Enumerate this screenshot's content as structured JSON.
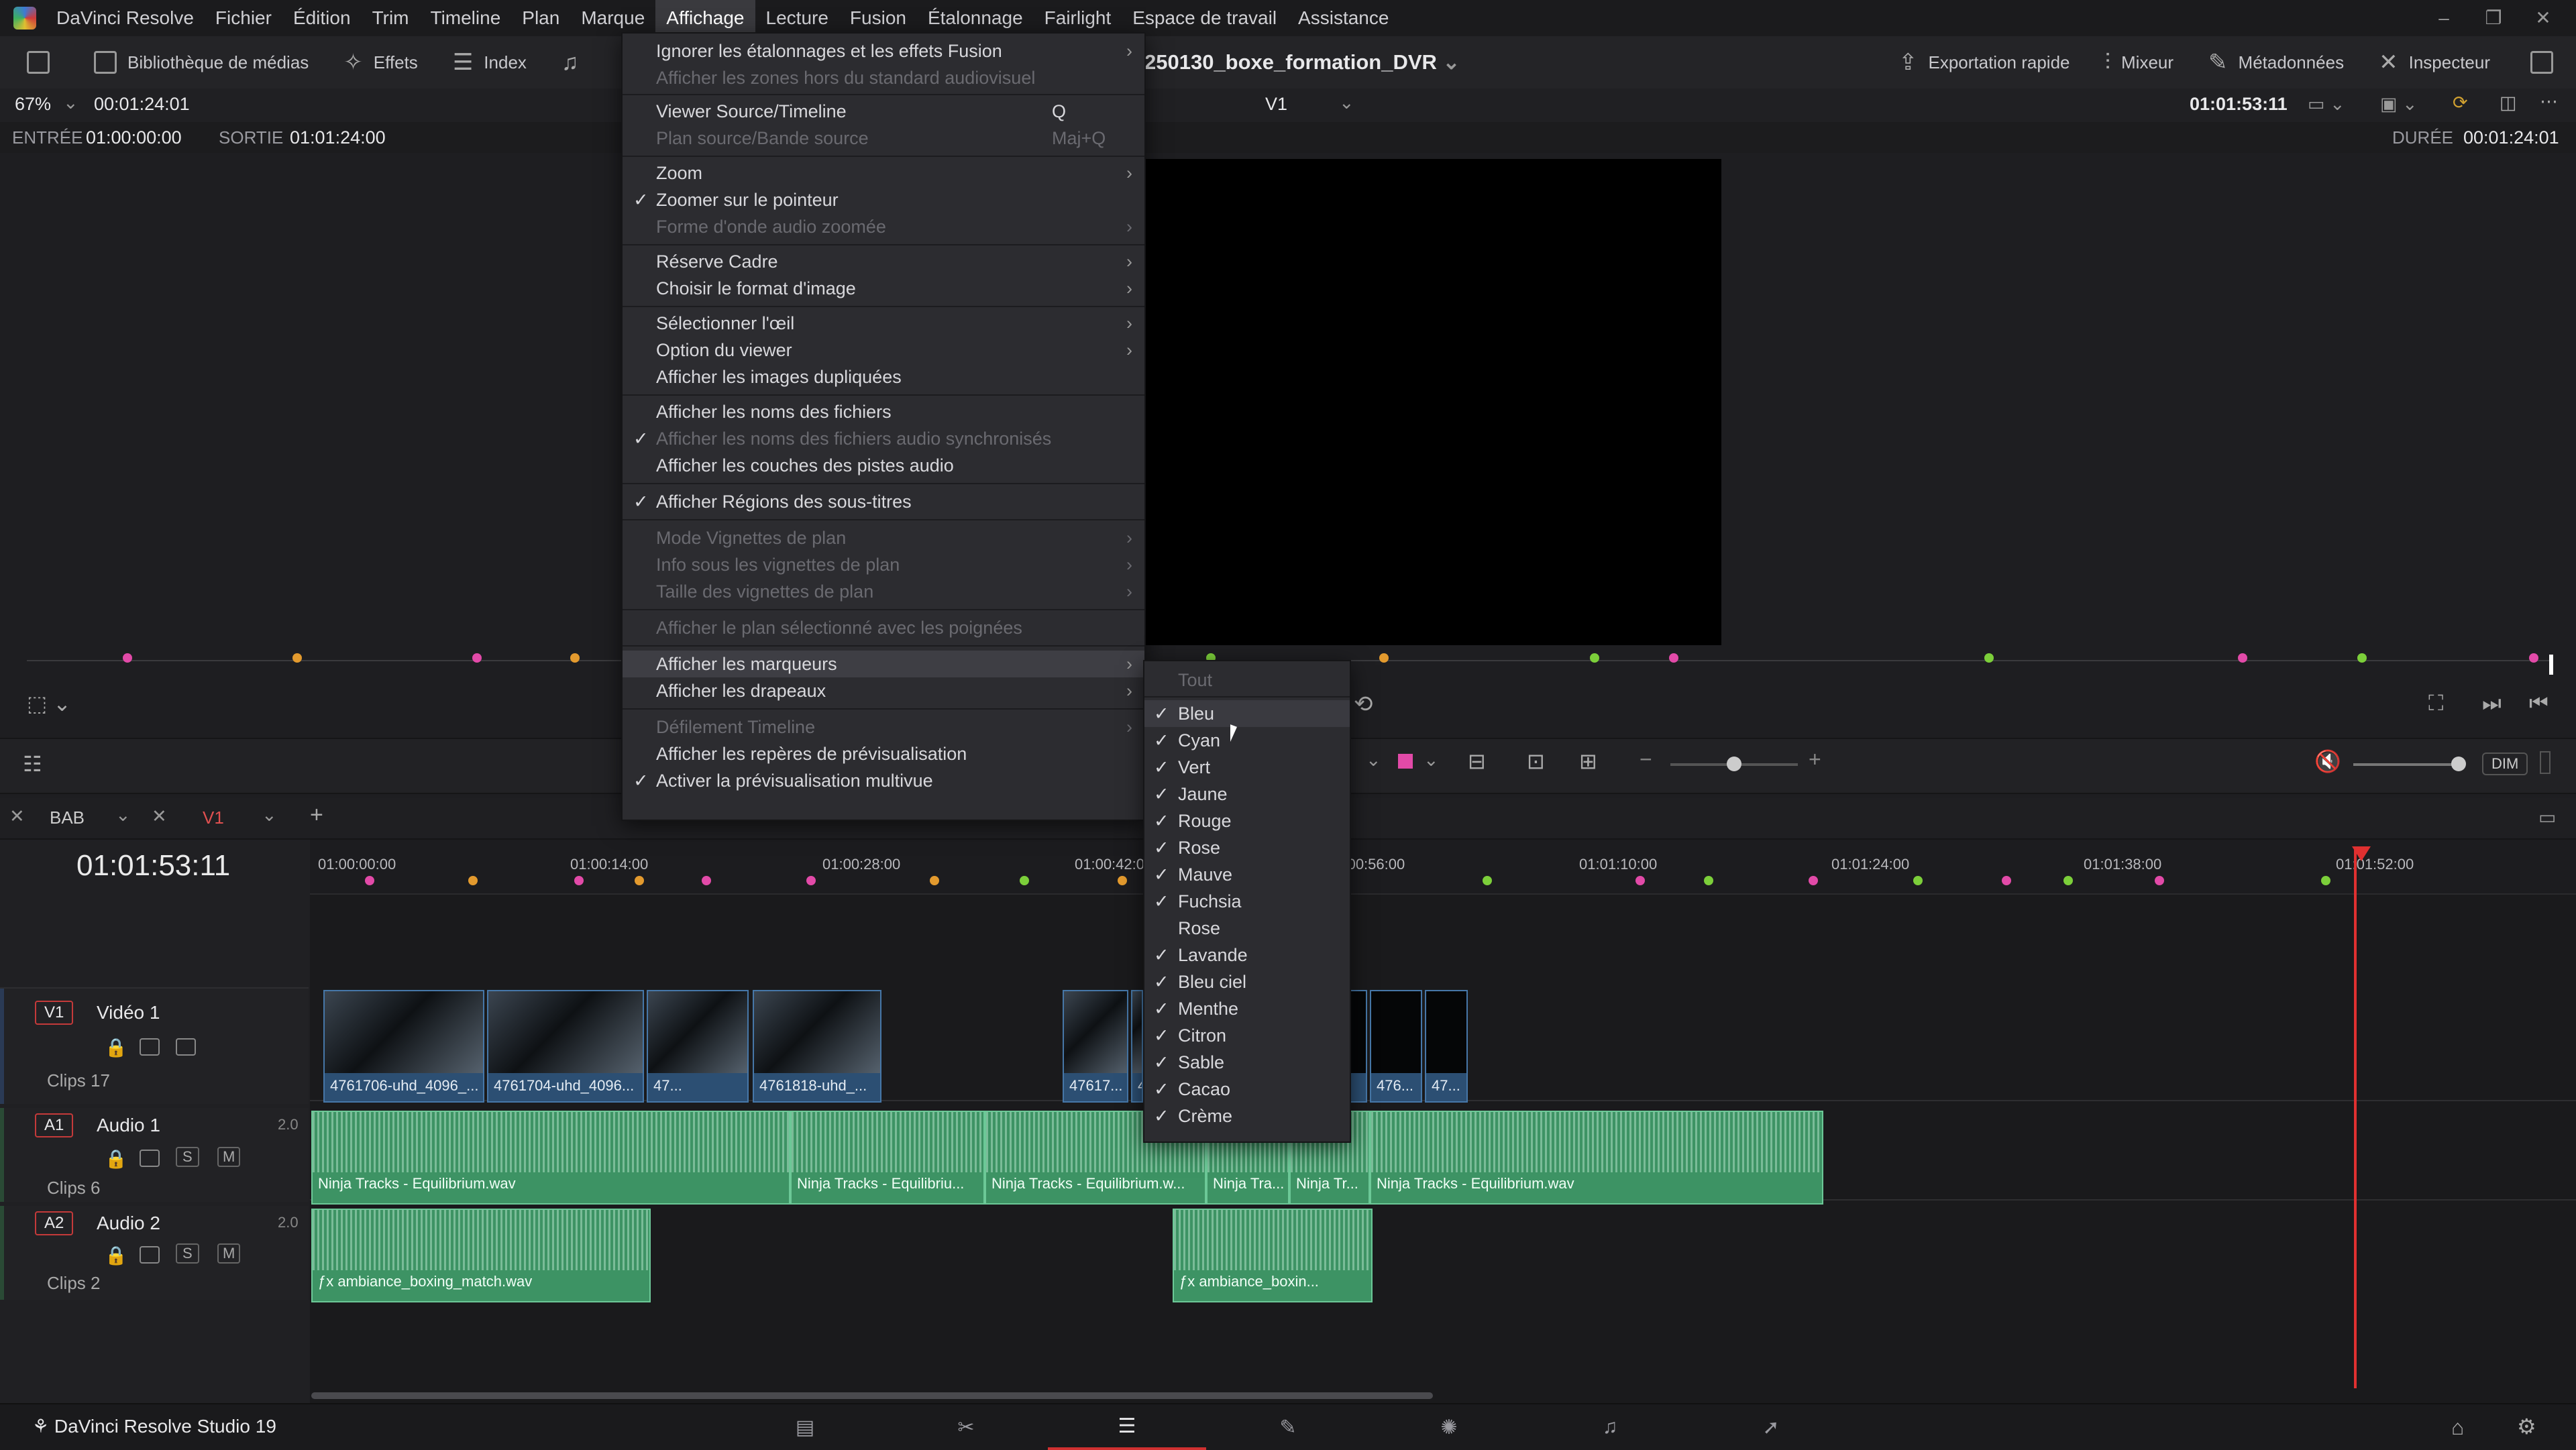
{
  "app": {
    "name": "DaVinci Resolve",
    "brand": "DaVinci Resolve Studio 19",
    "project": "250130_boxe_formation_DVR"
  },
  "menubar": [
    "DaVinci Resolve",
    "Fichier",
    "Édition",
    "Trim",
    "Timeline",
    "Plan",
    "Marque",
    "Affichage",
    "Lecture",
    "Fusion",
    "Étalonnage",
    "Fairlight",
    "Espace de travail",
    "Assistance"
  ],
  "toolbar": {
    "left": [
      "Bibliothèque de médias",
      "Effets",
      "Index"
    ],
    "right": [
      "Exportation rapide",
      "Mixeur",
      "Métadonnées",
      "Inspecteur"
    ]
  },
  "viewer": {
    "zoom": "67%",
    "source_tc": "00:01:24:01",
    "in_label": "ENTRÉE",
    "in_tc": "01:00:00:00",
    "out_label": "SORTIE",
    "out_tc": "01:01:24:00",
    "track": "V1",
    "program_tc": "01:01:53:11",
    "duration_label": "DURÉE",
    "duration_tc": "00:01:24:01"
  },
  "menu": {
    "items": [
      {
        "label": "Ignorer les étalonnages et les effets Fusion",
        "arrow": true
      },
      {
        "label": "Afficher les zones hors du standard audiovisuel",
        "disabled": true
      },
      {
        "label": "Viewer Source/Timeline",
        "shortcut": "Q"
      },
      {
        "label": "Plan source/Bande source",
        "shortcut": "Maj+Q",
        "disabled": true
      },
      {
        "label": "Zoom",
        "arrow": true
      },
      {
        "label": "Zoomer sur le pointeur",
        "checked": true
      },
      {
        "label": "Forme d'onde audio zoomée",
        "arrow": true,
        "disabled": true
      },
      {
        "label": "Réserve Cadre",
        "arrow": true
      },
      {
        "label": "Choisir le format d'image",
        "arrow": true
      },
      {
        "label": "Sélectionner l'œil",
        "arrow": true
      },
      {
        "label": "Option du viewer",
        "arrow": true
      },
      {
        "label": "Afficher les images dupliquées"
      },
      {
        "label": "Afficher les noms des fichiers"
      },
      {
        "label": "Afficher les noms des fichiers audio synchronisés",
        "checked": true,
        "disabled": true
      },
      {
        "label": "Afficher les couches des pistes audio"
      },
      {
        "label": "Afficher Régions des sous-titres",
        "checked": true
      },
      {
        "label": "Mode Vignettes de plan",
        "arrow": true,
        "disabled": true
      },
      {
        "label": "Info sous les vignettes de plan",
        "arrow": true,
        "disabled": true
      },
      {
        "label": "Taille des vignettes de plan",
        "arrow": true,
        "disabled": true
      },
      {
        "label": "Afficher le plan sélectionné avec les poignées",
        "disabled": true
      },
      {
        "label": "Afficher les marqueurs",
        "arrow": true,
        "highlighted": true
      },
      {
        "label": "Afficher les drapeaux",
        "arrow": true
      },
      {
        "label": "Défilement Timeline",
        "arrow": true,
        "disabled": true
      },
      {
        "label": "Afficher les repères de prévisualisation"
      },
      {
        "label": "Activer la prévisualisation multivue",
        "checked": true
      }
    ]
  },
  "submenu": {
    "items": [
      {
        "label": "Tout",
        "disabled": true
      },
      {
        "label": "Bleu",
        "checked": true,
        "highlighted": true
      },
      {
        "label": "Cyan",
        "checked": true
      },
      {
        "label": "Vert",
        "checked": true
      },
      {
        "label": "Jaune",
        "checked": true
      },
      {
        "label": "Rouge",
        "checked": true
      },
      {
        "label": "Rose",
        "checked": true
      },
      {
        "label": "Mauve",
        "checked": true
      },
      {
        "label": "Fuchsia",
        "checked": true
      },
      {
        "label": "Rose",
        "checked": false
      },
      {
        "label": "Lavande",
        "checked": true
      },
      {
        "label": "Bleu ciel",
        "checked": true
      },
      {
        "label": "Menthe",
        "checked": true
      },
      {
        "label": "Citron",
        "checked": true
      },
      {
        "label": "Sable",
        "checked": true
      },
      {
        "label": "Cacao",
        "checked": true
      },
      {
        "label": "Crème",
        "checked": true
      }
    ]
  },
  "timeline": {
    "bin": "BAB",
    "tab": "V1",
    "timecode": "01:01:53:11",
    "ruler": [
      "01:00:00:00",
      "01:00:14:00",
      "01:00:28:00",
      "01:00:42:00",
      "01:00:56:00",
      "01:01:10:00",
      "01:01:24:00",
      "01:01:38:00",
      "01:01:52:00"
    ],
    "tracks": [
      {
        "id": "V1",
        "name": "Vidéo 1",
        "clips": "Clips 17"
      },
      {
        "id": "A1",
        "name": "Audio 1",
        "format": "2.0",
        "clips": "Clips 6"
      },
      {
        "id": "A2",
        "name": "Audio 2",
        "format": "2.0",
        "clips": "Clips 2"
      }
    ],
    "video_clips": [
      "4761706-uhd_4096_...",
      "4761704-uhd_4096...",
      "47...",
      "4761818-uhd_...",
      "47617...",
      "4",
      "476...",
      "47..."
    ],
    "audio1_clips": [
      "Ninja Tracks - Equilibrium.wav",
      "Ninja Tracks - Equilibriu...",
      "Ninja Tracks - Equilibrium.w...",
      "Ninja Tra...",
      "Ninja Tr...",
      "Ninja Tracks - Equilibrium.wav"
    ],
    "audio2_clips": [
      "ambiance_boxing_match.wav",
      "ambiance_boxin..."
    ],
    "solo": "S",
    "mute": "M",
    "dim": "DIM"
  },
  "colors": {
    "playhead": "#e03030",
    "video_clip": "#2c4f73",
    "audio_clip": "#3d9364",
    "marker_pink": "#e24aa8",
    "marker_orange": "#e39a2e",
    "marker_green": "#7ccf3a"
  },
  "pages": [
    "media-page-icon",
    "cut-page-icon",
    "edit-page-icon",
    "fusion-page-icon",
    "color-page-icon",
    "fairlight-page-icon",
    "deliver-page-icon"
  ]
}
